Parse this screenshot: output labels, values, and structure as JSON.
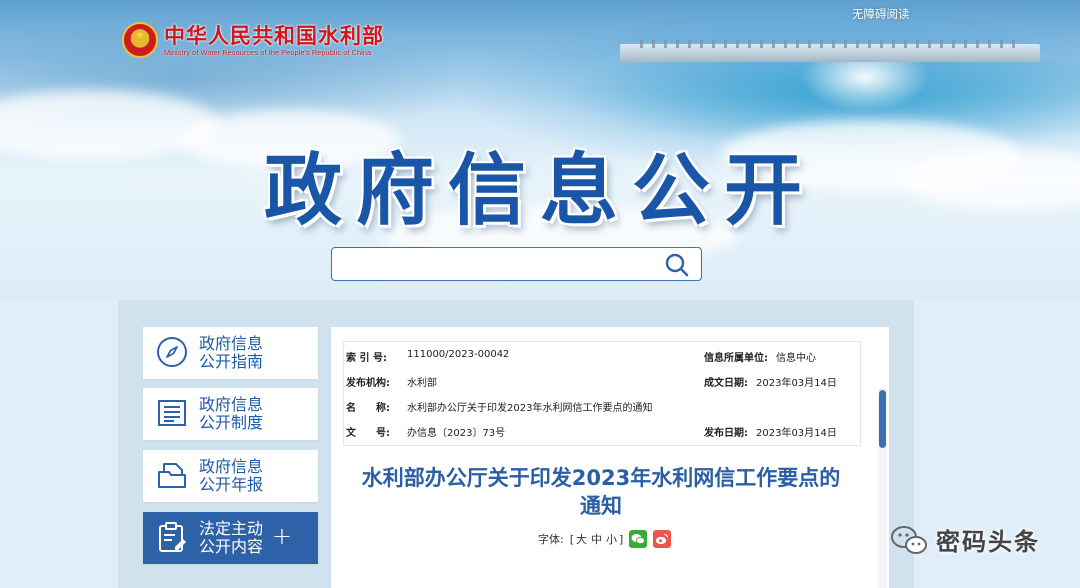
{
  "header": {
    "ministry_cn": "中华人民共和国水利部",
    "ministry_en": "Ministry of Water Resources of the People's Republic of China",
    "accessibility_link": "无障碍阅读",
    "page_title": "政府信息公开"
  },
  "search": {
    "value": "",
    "placeholder": ""
  },
  "sidebar": {
    "items": [
      {
        "label": "政府信息\n公开指南",
        "icon": "compass-icon",
        "active": false
      },
      {
        "label": "政府信息\n公开制度",
        "icon": "document-list-icon",
        "active": false
      },
      {
        "label": "政府信息\n公开年报",
        "icon": "folder-icon",
        "active": false
      },
      {
        "label": "法定主动\n公开内容",
        "icon": "clipboard-edit-icon",
        "active": true,
        "expand": "+"
      }
    ]
  },
  "meta": {
    "index_label": "索 引 号:",
    "index_value": "111000/2023-00042",
    "unit_label": "信息所属单位:",
    "unit_value": "信息中心",
    "issuer_label": "发布机构:",
    "issuer_value": "水利部",
    "created_label": "成文日期:",
    "created_value": "2023年03月14日",
    "name_label": "名　　称:",
    "name_value": "水利部办公厅关于印发2023年水利网信工作要点的通知",
    "docno_label": "文　　号:",
    "docno_value": "办信息〔2023〕73号",
    "published_label": "发布日期:",
    "published_value": "2023年03月14日"
  },
  "document": {
    "title_line1": "水利部办公厅关于印发2023年水利网信工作要点的",
    "title_line2": "通知",
    "font_label": "字体:",
    "bracket_open": "[",
    "size_large": "大",
    "size_medium": "中",
    "size_small": "小",
    "bracket_close": "]",
    "share_wechat": "wechat-icon",
    "share_weibo": "weibo-icon"
  },
  "watermark": {
    "text": "密码头条"
  },
  "colors": {
    "primary": "#2d62a8",
    "title_blue": "#1a56a8",
    "logo_red": "#d0151b",
    "panel": "#cfe2ee"
  }
}
